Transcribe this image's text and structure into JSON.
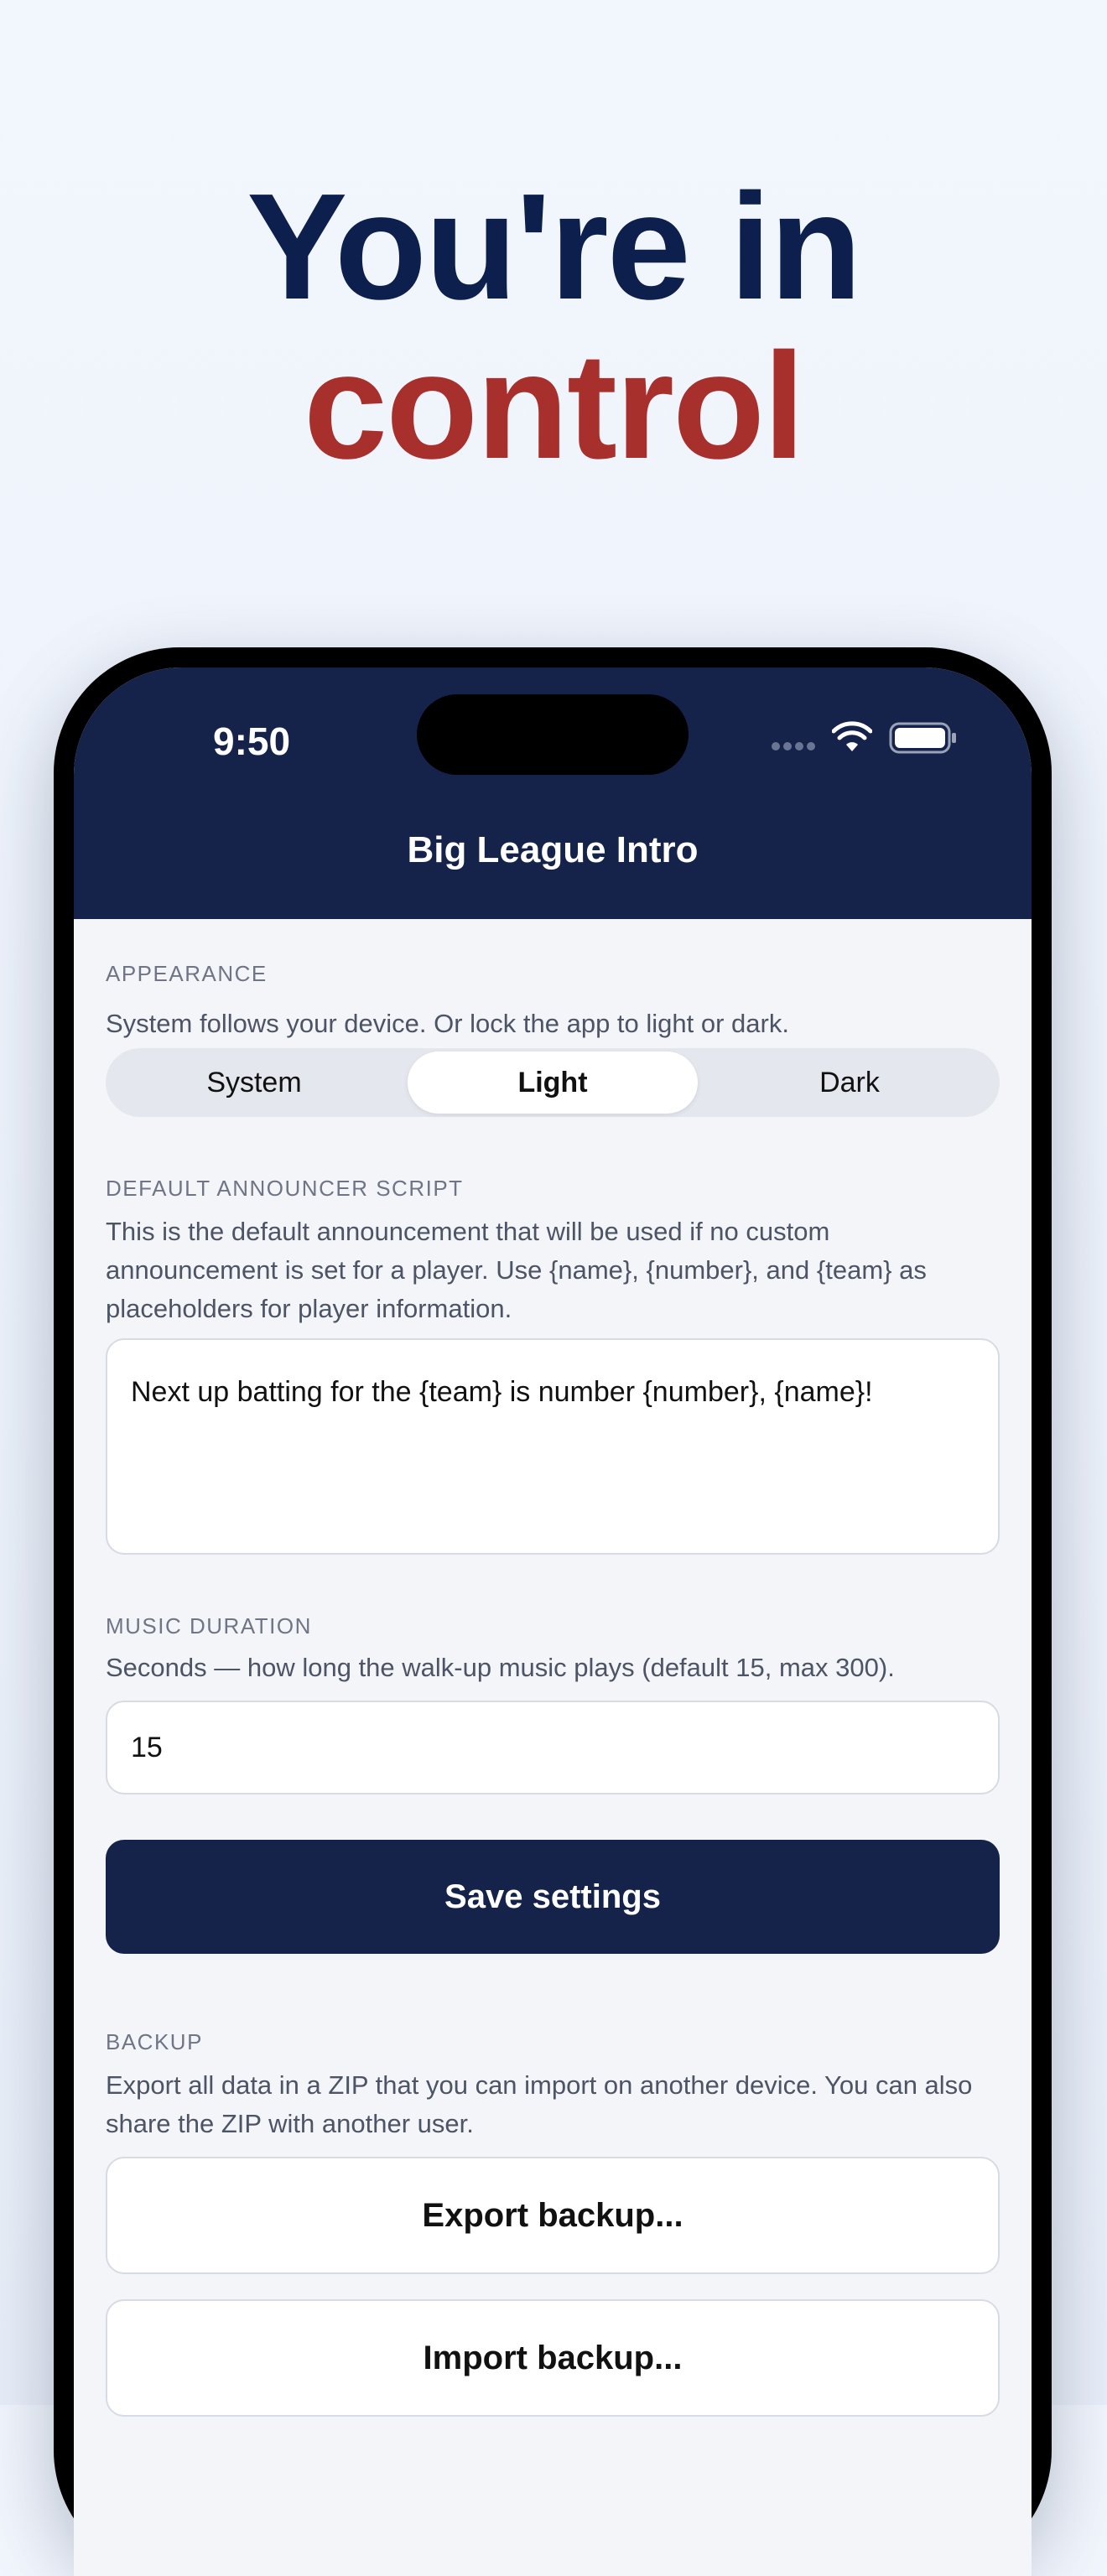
{
  "headline": {
    "line1": "You're in",
    "line2": "control"
  },
  "status_bar": {
    "time": "9:50"
  },
  "app": {
    "title": "Big League Intro"
  },
  "appearance": {
    "label": "APPEARANCE",
    "description": "System follows your device. Or lock the app to light or dark.",
    "options": [
      "System",
      "Light",
      "Dark"
    ],
    "selected": "Light"
  },
  "announcer": {
    "label": "DEFAULT ANNOUNCER SCRIPT",
    "description": "This is the default announcement that will be used if no custom announcement is set for a player. Use {name}, {number}, and {team} as placeholders for player information.",
    "value": "Next up batting for the {team} is number {number}, {name}!"
  },
  "music": {
    "label": "MUSIC DURATION",
    "description": "Seconds — how long the walk-up music plays (default 15, max 300).",
    "value": "15"
  },
  "save_button": "Save settings",
  "backup": {
    "label": "BACKUP",
    "description": "Export all data in a ZIP that you can import on another device. You can also share the ZIP with another user.",
    "export_label": "Export backup...",
    "import_label": "Import backup..."
  },
  "colors": {
    "navy": "#15234a",
    "headline_blue": "#0c1f4d",
    "headline_red": "#a7302d"
  }
}
